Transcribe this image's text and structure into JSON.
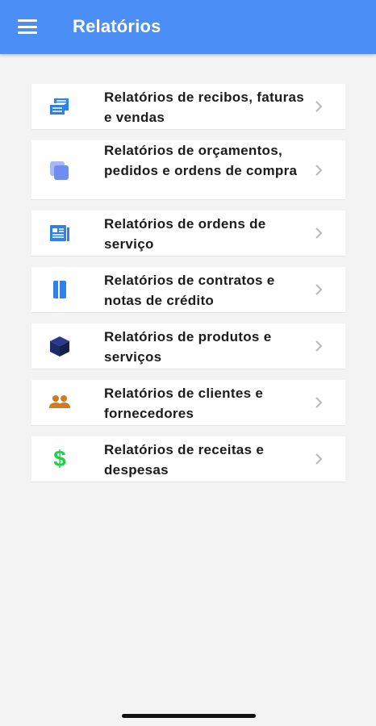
{
  "header": {
    "title": "Relatórios",
    "menu_icon": "hamburger-menu-icon",
    "background_color": "#4b8ef5"
  },
  "reports": [
    {
      "label": "Relatórios de recibos, faturas e vendas",
      "icon": "receipt-icon",
      "icon_color": "#2f80e8"
    },
    {
      "label": "Relatórios de orçamentos, pedidos e ordens de compra",
      "icon": "copy-icon",
      "icon_color": "#6f8df0"
    },
    {
      "label": "Relatórios de ordens de serviço",
      "icon": "document-icon",
      "icon_color": "#2f80e8"
    },
    {
      "label": "Relatórios de contratos e notas de crédito",
      "icon": "book-icon",
      "icon_color": "#2f80e8"
    },
    {
      "label": "Relatórios de produtos e serviços",
      "icon": "box-icon",
      "icon_color": "#1f2a6b"
    },
    {
      "label": "Relatórios de clientes e fornecedores",
      "icon": "people-icon",
      "icon_color": "#d17a20"
    },
    {
      "label": "Relatórios de receitas e despesas",
      "icon": "dollar-icon",
      "icon_color": "#22d04a"
    }
  ],
  "chevron_icon": "chevron-right-icon"
}
